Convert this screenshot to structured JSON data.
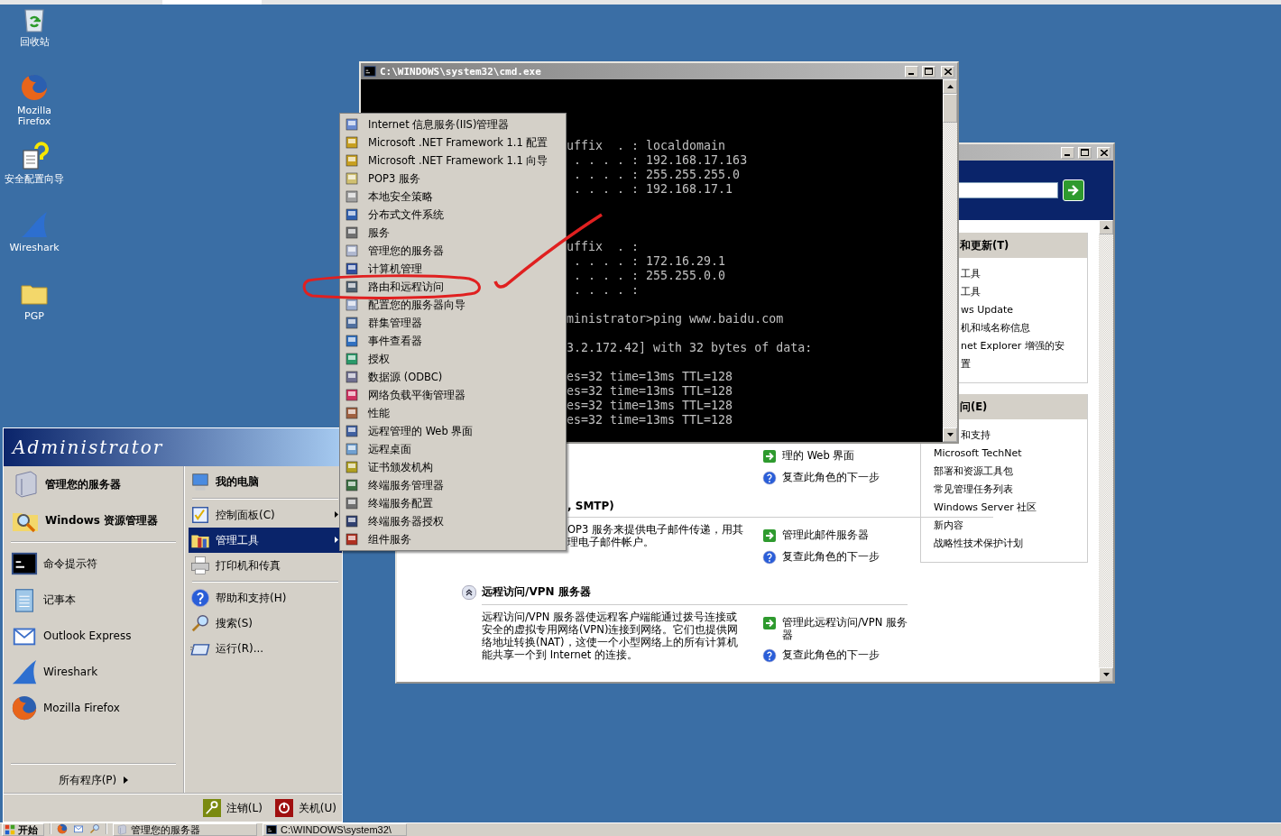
{
  "desktop_icons": [
    {
      "label": "回收站",
      "kind": "recycle"
    },
    {
      "label": "Mozilla\nFirefox",
      "kind": "browser"
    },
    {
      "label": "安全配置向导",
      "kind": "wizard"
    },
    {
      "label": "Wireshark",
      "kind": "fin"
    },
    {
      "label": "PGP",
      "kind": "folder"
    }
  ],
  "server_window": {
    "sections": [
      {
        "actions": [
          {
            "kind": "go",
            "label": "理的 Web 界面"
          },
          {
            "kind": "help",
            "label": "复查此角色的下一步"
          }
        ]
      },
      {
        "title": ", SMTP)",
        "description": [
          "OP3 服务来提供电子邮件传递，用其",
          "理电子邮件帐户。"
        ],
        "actions": [
          {
            "kind": "go",
            "label": "管理此邮件服务器"
          },
          {
            "kind": "help",
            "label": "复查此角色的下一步"
          }
        ]
      },
      {
        "title": "远程访问/VPN 服务器",
        "expanded": true,
        "description": [
          "远程访问/VPN 服务器使远程客户端能通过拨号连接或",
          "安全的虚拟专用网络(VPN)连接到网络。它们也提供网",
          "络地址转换(NAT)，这使一个小型网络上的所有计算机",
          "能共享一个到 Internet 的连接。"
        ],
        "actions": [
          {
            "kind": "go",
            "label": "管理此远程访问/VPN 服务器"
          },
          {
            "kind": "help",
            "label": "复查此角色的下一步"
          }
        ]
      }
    ],
    "panels": [
      {
        "title": "和更新(T)",
        "items": [
          "工具",
          "工具",
          "ws Update",
          "机和域名称信息",
          "net Explorer 增强的安",
          "置"
        ]
      },
      {
        "title": "问(E)",
        "items": [
          "和支持",
          "Microsoft TechNet",
          "部署和资源工具包",
          "常见管理任务列表",
          "Windows Server 社区",
          "新内容",
          "战略性技术保护计划"
        ]
      }
    ]
  },
  "cmd_window": {
    "title": "C:\\WINDOWS\\system32\\cmd.exe",
    "blocks": [
      [
        "uffix  . : localdomain",
        " . . . . : 192.168.17.163",
        " . . . . : 255.255.255.0",
        " . . . . : 192.168.17.1"
      ],
      [
        "uffix  . :",
        " . . . . : 172.16.29.1",
        " . . . . : 255.255.0.0",
        " . . . . :"
      ],
      [
        "ministrator>ping www.baidu.com"
      ],
      [
        "3.2.172.42] with 32 bytes of data:"
      ],
      [
        "es=32 time=13ms TTL=128",
        "es=32 time=13ms TTL=128",
        "es=32 time=13ms TTL=128",
        "es=32 time=13ms TTL=128"
      ]
    ]
  },
  "admin_tools_menu": {
    "items": [
      "Internet 信息服务(IIS)管理器",
      "Microsoft .NET Framework 1.1 配置",
      "Microsoft .NET Framework 1.1 向导",
      "POP3 服务",
      "本地安全策略",
      "分布式文件系统",
      "服务",
      "管理您的服务器",
      "计算机管理",
      "路由和远程访问",
      "配置您的服务器向导",
      "群集管理器",
      "事件查看器",
      "授权",
      "数据源 (ODBC)",
      "网络负载平衡管理器",
      "性能",
      "远程管理的 Web 界面",
      "远程桌面",
      "证书颁发机构",
      "终端服务管理器",
      "终端服务配置",
      "终端服务器授权",
      "组件服务"
    ]
  },
  "start_menu": {
    "user": "Administrator",
    "pinned": [
      {
        "label": "管理您的服务器",
        "kind": "server"
      },
      {
        "label": "Windows 资源管理器",
        "kind": "explorer"
      }
    ],
    "recent": [
      {
        "label": "命令提示符",
        "kind": "cmd"
      },
      {
        "label": "记事本",
        "kind": "notepad"
      },
      {
        "label": "Outlook Express",
        "kind": "mail"
      },
      {
        "label": "Wireshark",
        "kind": "fin"
      },
      {
        "label": "Mozilla Firefox",
        "kind": "browser"
      }
    ],
    "all_programs": "所有程序(P)",
    "places": [
      [
        {
          "label": "我的电脑",
          "kind": "computer",
          "submenu": false,
          "selected": false
        }
      ],
      [
        {
          "label": "控制面板(C)",
          "kind": "control",
          "submenu": true,
          "selected": false
        },
        {
          "label": "管理工具",
          "kind": "tools",
          "submenu": true,
          "selected": true
        },
        {
          "label": "打印机和传真",
          "kind": "printer",
          "submenu": false,
          "selected": false
        }
      ],
      [
        {
          "label": "帮助和支持(H)",
          "kind": "help",
          "submenu": false,
          "selected": false
        },
        {
          "label": "搜索(S)",
          "kind": "search",
          "submenu": false,
          "selected": false
        },
        {
          "label": "运行(R)...",
          "kind": "run",
          "submenu": false,
          "selected": false
        }
      ]
    ],
    "log_off": "注销(L)",
    "shut_down": "关机(U)"
  },
  "taskbar": {
    "start": "开始",
    "tasks": [
      {
        "label": "管理您的服务器",
        "kind": "server"
      },
      {
        "label": "C:\\WINDOWS\\system32\\",
        "kind": "cmd"
      }
    ]
  }
}
